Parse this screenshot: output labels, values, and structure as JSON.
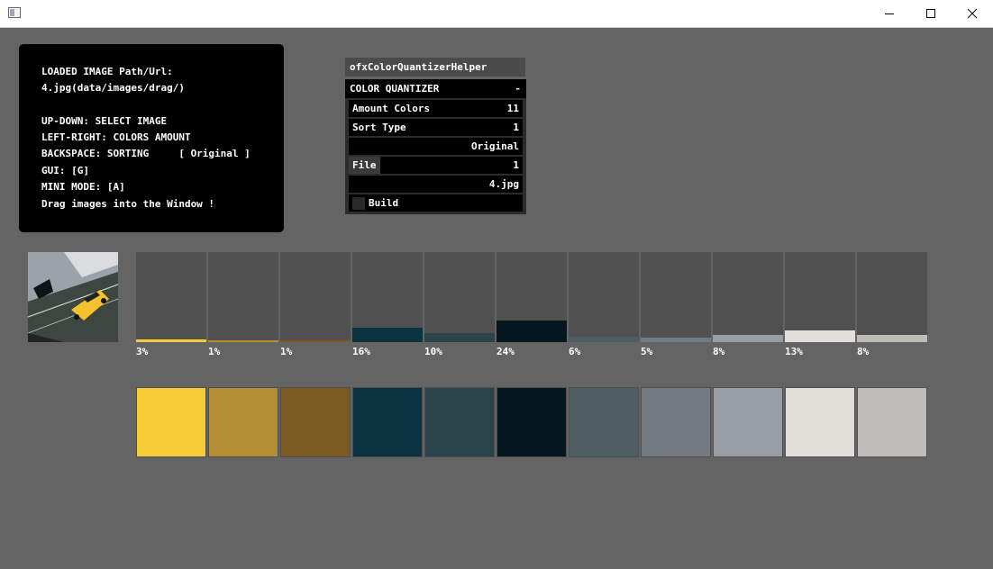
{
  "info": {
    "lines": [
      "LOADED IMAGE Path/Url:",
      "4.jpg(data/images/drag/)",
      "",
      "UP-DOWN: SELECT IMAGE",
      "LEFT-RIGHT: COLORS AMOUNT",
      "BACKSPACE: SORTING     [ Original ]",
      "GUI: [G]",
      "MINI MODE: [A]",
      "Drag images into the Window !"
    ]
  },
  "gui": {
    "title": "ofxColorQuantizerHelper",
    "section": "COLOR QUANTIZER",
    "collapse": "-",
    "amount_label": "Amount Colors",
    "amount_value": "11",
    "sort_label": "Sort Type",
    "sort_value": "1",
    "sort_name": "Original",
    "file_label": "File",
    "file_value": "1",
    "file_name": "4.jpg",
    "build_label": "Build"
  },
  "palette": [
    {
      "percent": "3%",
      "fraction": 0.03,
      "color": "#f6cd38"
    },
    {
      "percent": "1%",
      "fraction": 0.01,
      "color": "#b48e35"
    },
    {
      "percent": "1%",
      "fraction": 0.01,
      "color": "#7a5a22"
    },
    {
      "percent": "16%",
      "fraction": 0.16,
      "color": "#0a323f"
    },
    {
      "percent": "10%",
      "fraction": 0.1,
      "color": "#2a4449"
    },
    {
      "percent": "24%",
      "fraction": 0.24,
      "color": "#06161e"
    },
    {
      "percent": "6%",
      "fraction": 0.06,
      "color": "#4e5e62"
    },
    {
      "percent": "5%",
      "fraction": 0.05,
      "color": "#737b82"
    },
    {
      "percent": "8%",
      "fraction": 0.08,
      "color": "#989fa4"
    },
    {
      "percent": "13%",
      "fraction": 0.13,
      "color": "#e2dfdb"
    },
    {
      "percent": "8%",
      "fraction": 0.08,
      "color": "#bdbcb8"
    }
  ]
}
